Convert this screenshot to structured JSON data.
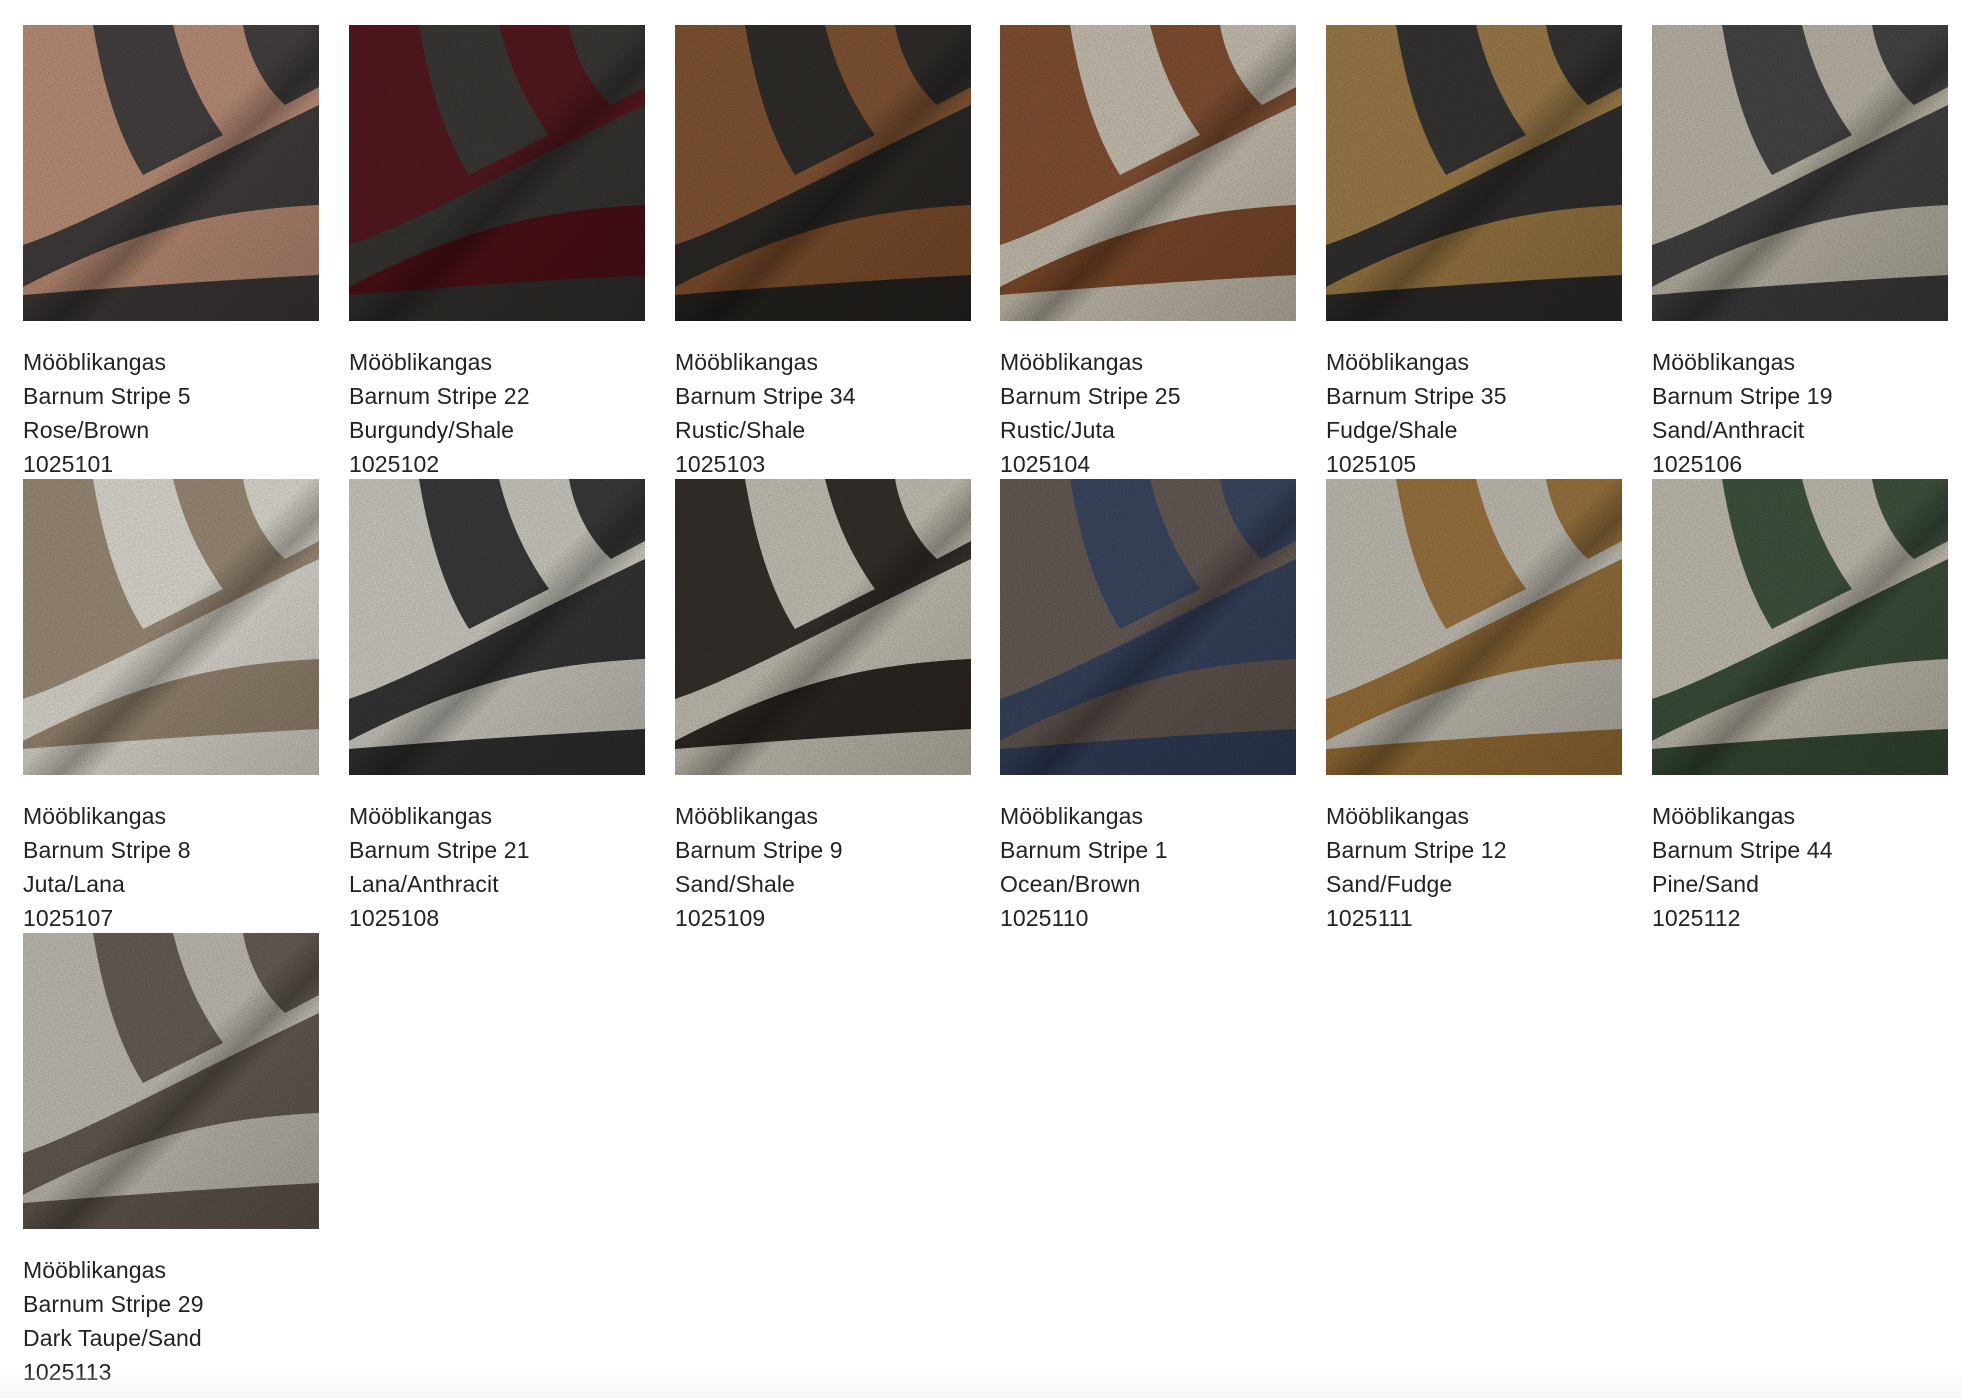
{
  "products": [
    {
      "category": "Mööblikangas",
      "name": "Barnum Stripe 5",
      "color_name": "Rose/Brown",
      "code": "1025101",
      "swatch": {
        "a": "#c99a82",
        "b": "#494544"
      }
    },
    {
      "category": "Mööblikangas",
      "name": "Barnum Stripe 22",
      "color_name": "Burgundy/Shale",
      "code": "1025102",
      "swatch": {
        "a": "#5a1a22",
        "b": "#3f3d3a"
      }
    },
    {
      "category": "Mööblikangas",
      "name": "Barnum Stripe 34",
      "color_name": "Rustic/Shale",
      "code": "1025103",
      "swatch": {
        "a": "#8b5a38",
        "b": "#33302d"
      }
    },
    {
      "category": "Mööblikangas",
      "name": "Barnum Stripe 25",
      "color_name": "Rustic/Juta",
      "code": "1025104",
      "swatch": {
        "a": "#8c5636",
        "b": "#d8d0c0"
      }
    },
    {
      "category": "Mööblikangas",
      "name": "Barnum Stripe 35",
      "color_name": "Fudge/Shale",
      "code": "1025105",
      "swatch": {
        "a": "#a8854f",
        "b": "#3a3836"
      }
    },
    {
      "category": "Mööblikangas",
      "name": "Barnum Stripe 19",
      "color_name": "Sand/Anthracit",
      "code": "1025106",
      "swatch": {
        "a": "#cac4b4",
        "b": "#4a4a4a"
      }
    },
    {
      "category": "Mööblikangas",
      "name": "Barnum Stripe 8",
      "color_name": "Juta/Lana",
      "code": "1025107",
      "swatch": {
        "a": "#a89680",
        "b": "#f1ede3"
      }
    },
    {
      "category": "Mööblikangas",
      "name": "Barnum Stripe 21",
      "color_name": "Lana/Anthracit",
      "code": "1025108",
      "swatch": {
        "a": "#dedbd2",
        "b": "#3e3e3e"
      }
    },
    {
      "category": "Mööblikangas",
      "name": "Barnum Stripe 9",
      "color_name": "Sand/Shale",
      "code": "1025109",
      "swatch": {
        "a": "#3a332e",
        "b": "#d6d1c4"
      }
    },
    {
      "category": "Mööblikangas",
      "name": "Barnum Stripe 1",
      "color_name": "Ocean/Brown",
      "code": "1025110",
      "swatch": {
        "a": "#6d625c",
        "b": "#3f4c68"
      }
    },
    {
      "category": "Mööblikangas",
      "name": "Barnum Stripe 12",
      "color_name": "Sand/Fudge",
      "code": "1025111",
      "swatch": {
        "a": "#d2cdc1",
        "b": "#a57c44"
      }
    },
    {
      "category": "Mööblikangas",
      "name": "Barnum Stripe 44",
      "color_name": "Pine/Sand",
      "code": "1025112",
      "swatch": {
        "a": "#d1ccbe",
        "b": "#445844"
      }
    },
    {
      "category": "Mööblikangas",
      "name": "Barnum Stripe 29",
      "color_name": "Dark Taupe/Sand",
      "code": "1025113",
      "swatch": {
        "a": "#d0ccc1",
        "b": "#6f655c"
      }
    }
  ]
}
